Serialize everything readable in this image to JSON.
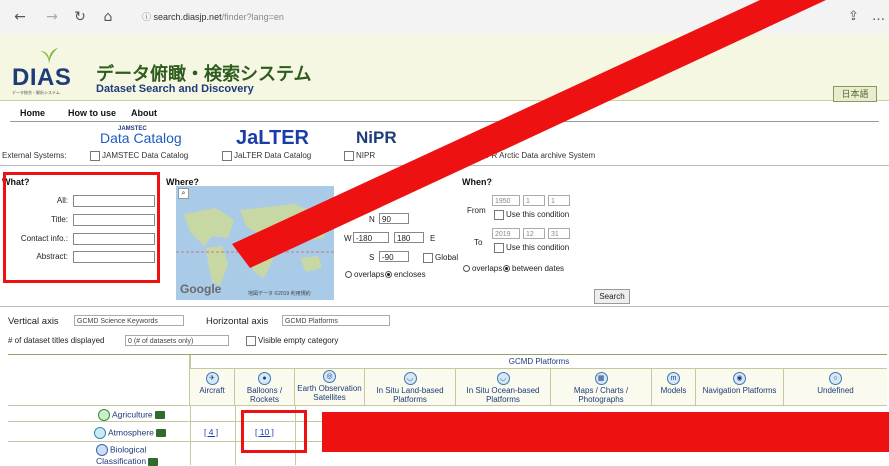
{
  "browser": {
    "url_host": "search.diasjp.net",
    "url_path": "/finder?lang=en"
  },
  "site": {
    "logo_text": "DIAS",
    "logo_sub": "データ統合・解析システム",
    "title_ja": "データ俯瞰・検索システム",
    "title_en": "Dataset Search and Discovery",
    "lang_button": "日本語"
  },
  "menu": {
    "home": "Home",
    "how_to_use": "How to use",
    "about": "About"
  },
  "systems": {
    "jamstec_logo_top": "JAMSTEC",
    "jamstec_logo": "Data Catalog",
    "jalter_logo": "JaLTER",
    "nipr_logo": "NiPR",
    "label": "External Systems:",
    "items": [
      "JAMSTEC Data Catalog",
      "JaLTER Data Catalog",
      "NIPR",
      "IPR Arctic Data archive System"
    ]
  },
  "what": {
    "title": "What?",
    "fields": [
      "All:",
      "Title:",
      "Contact info.:",
      "Abstract:"
    ]
  },
  "where": {
    "title": "Where?",
    "google": "Google",
    "map_credit": "地図データ ©2019  利用規約",
    "n_label": "N",
    "n_value": "90",
    "w_label": "W",
    "w_value": "-180",
    "e_value": "180",
    "e_label": "E",
    "s_label": "S",
    "s_value": "-90",
    "global_label": "Global",
    "overlaps": "overlaps",
    "encloses": "encloses"
  },
  "when": {
    "title": "When?",
    "from_label": "From",
    "to_label": "To",
    "from_year": "1950",
    "from_month": "1",
    "from_day": "1",
    "to_year": "2019",
    "to_month": "12",
    "to_day": "31",
    "use_condition": "Use this condition",
    "overlaps": "overlaps",
    "between": "between dates",
    "search_button": "Search"
  },
  "axes": {
    "vertical_label": "Vertical axis",
    "vertical_value": "GCMD Science Keywords",
    "horizontal_label": "Horizontal axis",
    "horizontal_value": "GCMD Platforms",
    "count_label": "# of dataset titles displayed",
    "count_value": "0 (# of datasets only)",
    "visible_empty": "Visible empty category"
  },
  "table": {
    "group_header": "GCMD Platforms",
    "columns": [
      "Aircraft",
      "Balloons / Rockets",
      "Earth Observation Satellites",
      "In Situ Land-based Platforms",
      "In Situ Ocean-based Platforms",
      "Maps / Charts / Photographs",
      "Models",
      "Navigation Platforms",
      "Undefined"
    ],
    "rows": [
      {
        "label": "Agriculture"
      },
      {
        "label": "Atmosphere",
        "aircraft": "[ 4 ]",
        "balloons": "[ 10 ]"
      },
      {
        "label": "Biological Classification"
      }
    ]
  },
  "colors": {
    "annotation_red": "#ee1111",
    "header_bg": "#f5f7e2",
    "link_blue": "#1a3da8"
  }
}
